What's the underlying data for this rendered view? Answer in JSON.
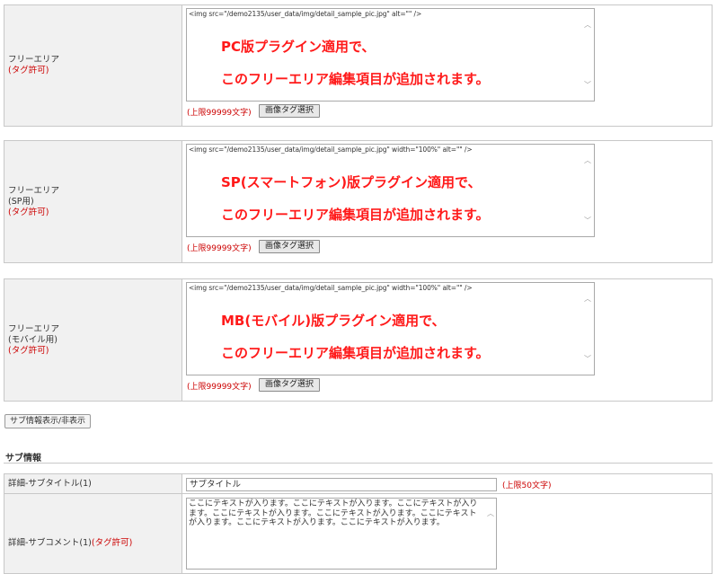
{
  "free_areas": [
    {
      "label_lines": [
        "フリーエリア"
      ],
      "tag_label": "(タグ許可)",
      "code": "<img src=\"/demo2135/user_data/img/detail_sample_pic.jpg\" alt=\"\" />",
      "note_line1": "PC版プラグイン適用で、",
      "note_line2": "このフリーエリア編集項目が追加されます。",
      "limit": "(上限99999文字)",
      "button": "画像タグ選択"
    },
    {
      "label_lines": [
        "フリーエリア",
        "(SP用)"
      ],
      "tag_label": "(タグ許可)",
      "code": "<img src=\"/demo2135/user_data/img/detail_sample_pic.jpg\" width=\"100%\" alt=\"\" />",
      "note_line1": "SP(スマートフォン)版プラグイン適用で、",
      "note_line2": "このフリーエリア編集項目が追加されます。",
      "limit": "(上限99999文字)",
      "button": "画像タグ選択"
    },
    {
      "label_lines": [
        "フリーエリア",
        "(モバイル用)"
      ],
      "tag_label": "(タグ許可)",
      "code": "<img src=\"/demo2135/user_data/img/detail_sample_pic.jpg\" width=\"100%\" alt=\"\" />",
      "note_line1": "MB(モバイル)版プラグイン適用で、",
      "note_line2": "このフリーエリア編集項目が追加されます。",
      "limit": "(上限99999文字)",
      "button": "画像タグ選択"
    }
  ],
  "toggle_button": "サブ情報表示/非表示",
  "section_title": "サブ情報",
  "sub_title_row": {
    "label": "詳細-サブタイトル(1)",
    "value": "サブタイトル",
    "limit": "(上限50文字)"
  },
  "sub_comment_row": {
    "label": "詳細-サブコメント(1)",
    "tag_label": "(タグ許可)",
    "value": "ここにテキストが入ります。ここにテキストが入ります。ここにテキストが入ります。ここにテキストが入ります。ここにテキストが入ります。ここにテキストが入ります。ここにテキストが入ります。ここにテキストが入ります。"
  },
  "colors": {
    "accent_red": "#cc0000",
    "note_red": "#ff1a1a",
    "label_bg": "#f1f1f1"
  }
}
